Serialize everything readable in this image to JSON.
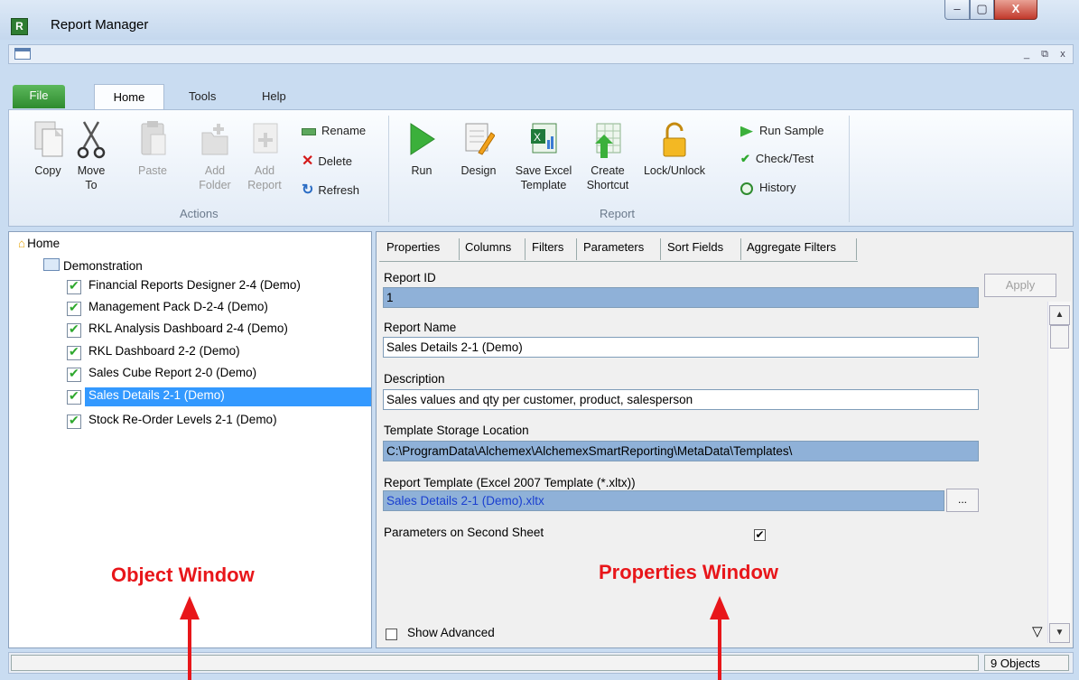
{
  "window": {
    "title": "Report Manager",
    "icon_letter": "R",
    "close_glyph": "X",
    "min_glyph": "–",
    "max_glyph": "▢"
  },
  "mdi": {
    "min": "_",
    "restore": "⧉",
    "close": "x"
  },
  "ribbon": {
    "tabs": [
      "File",
      "Home",
      "Tools",
      "Help"
    ],
    "actions": {
      "group_label": "Actions",
      "copy": "Copy",
      "move_to_1": "Move",
      "move_to_2": "To",
      "paste": "Paste",
      "add_folder_1": "Add",
      "add_folder_2": "Folder",
      "add_report_1": "Add",
      "add_report_2": "Report",
      "rename": "Rename",
      "delete": "Delete",
      "refresh": "Refresh"
    },
    "report": {
      "group_label": "Report",
      "run": "Run",
      "design": "Design",
      "save_excel_1": "Save Excel",
      "save_excel_2": "Template",
      "create_shortcut_1": "Create",
      "create_shortcut_2": "Shortcut",
      "lock_unlock": "Lock/Unlock",
      "run_sample": "Run Sample",
      "check_test": "Check/Test",
      "history": "History"
    }
  },
  "tree": {
    "root": "Home",
    "folder": "Demonstration",
    "items": [
      "Financial Reports Designer 2-4 (Demo)",
      "Management Pack D-2-4 (Demo)",
      "RKL Analysis Dashboard 2-4 (Demo)",
      "RKL Dashboard 2-2 (Demo)",
      "Sales Cube Report 2-0 (Demo)",
      "Sales Details 2-1 (Demo)",
      "Stock Re-Order Levels 2-1 (Demo)"
    ],
    "selected_index": 5
  },
  "properties": {
    "tabs": [
      "Properties",
      "Columns",
      "Filters",
      "Parameters",
      "Sort Fields",
      "Aggregate Filters"
    ],
    "apply": "Apply",
    "report_id_label": "Report ID",
    "report_id": "1",
    "report_name_label": "Report Name",
    "report_name": "Sales Details 2-1 (Demo)",
    "description_label": "Description",
    "description": "Sales values and qty per customer, product, salesperson",
    "storage_label": "Template Storage Location",
    "storage": "C:\\ProgramData\\Alchemex\\AlchemexSmartReporting\\MetaData\\Templates\\",
    "template_label": "Report Template (Excel 2007 Template (*.xltx))",
    "template": "Sales Details 2-1 (Demo).xltx",
    "browse": "...",
    "params_second_sheet_label": "Parameters on Second Sheet",
    "params_second_sheet": true,
    "show_advanced_label": "Show Advanced",
    "show_advanced": false,
    "filter_glyph": "▽"
  },
  "status": {
    "objects": "9 Objects"
  },
  "annotations": {
    "object_window": "Object Window",
    "properties_window": "Properties Window"
  }
}
